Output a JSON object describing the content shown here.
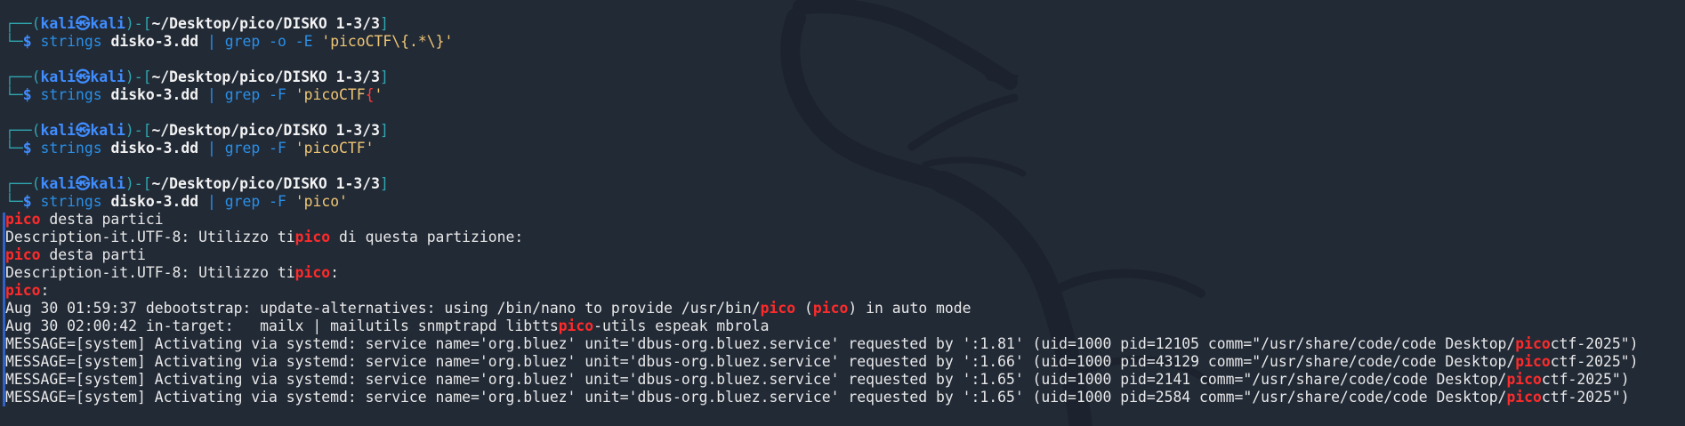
{
  "prompt": {
    "box_top": "┌──(",
    "box_bottom": "└─",
    "user": "kali㉿kali",
    "sep_open": ")-[",
    "path": "~/Desktop/pico/DISKO 1-3/3",
    "sep_close": "]",
    "dollar": "$"
  },
  "commands": [
    {
      "cmd": "strings",
      "file": "disko-3.dd",
      "pipe": "|",
      "grep": "grep -o -E",
      "pattern_pre": "'picoCTF\\{.*\\}'",
      "pattern_brace": "",
      "pattern_post": ""
    },
    {
      "cmd": "strings",
      "file": "disko-3.dd",
      "pipe": "|",
      "grep": "grep -F",
      "pattern_pre": "'picoCTF",
      "pattern_brace": "{",
      "pattern_post": "'"
    },
    {
      "cmd": "strings",
      "file": "disko-3.dd",
      "pipe": "|",
      "grep": "grep -F",
      "pattern_pre": "'picoCTF'",
      "pattern_brace": "",
      "pattern_post": ""
    },
    {
      "cmd": "strings",
      "file": "disko-3.dd",
      "pipe": "|",
      "grep": "grep -F",
      "pattern_pre": "'pico'",
      "pattern_brace": "",
      "pattern_post": ""
    }
  ],
  "output": [
    {
      "a": "",
      "m": "pico",
      "b": " desta partici",
      "m2": "",
      "c": "",
      "m3": "",
      "d": ""
    },
    {
      "a": "Description-it.UTF-8: Utilizzo ti",
      "m": "pico",
      "b": " di questa partizione:",
      "m2": "",
      "c": "",
      "m3": "",
      "d": ""
    },
    {
      "a": "",
      "m": "pico",
      "b": " desta parti",
      "m2": "",
      "c": "",
      "m3": "",
      "d": ""
    },
    {
      "a": "Description-it.UTF-8: Utilizzo ti",
      "m": "pico",
      "b": ":",
      "m2": "",
      "c": "",
      "m3": "",
      "d": ""
    },
    {
      "a": "",
      "m": "pico",
      "b": ":",
      "m2": "",
      "c": "",
      "m3": "",
      "d": ""
    },
    {
      "a": "Aug 30 01:59:37 debootstrap: update-alternatives: using /bin/nano to provide /usr/bin/",
      "m": "pico",
      "b": " (",
      "m2": "pico",
      "c": ") in auto mode",
      "m3": "",
      "d": ""
    },
    {
      "a": "Aug 30 02:00:42 in-target:   mailx | mailutils snmptrapd libtts",
      "m": "pico",
      "b": "-utils espeak mbrola",
      "m2": "",
      "c": "",
      "m3": "",
      "d": ""
    },
    {
      "a": "MESSAGE=[system] Activating via systemd: service name='org.bluez' unit='dbus-org.bluez.service' requested by ':1.81' (uid=1000 pid=12105 comm=\"/usr/share/code/code Desktop/",
      "m": "pico",
      "b": "ctf-2025\")",
      "m2": "",
      "c": "",
      "m3": "",
      "d": ""
    },
    {
      "a": "MESSAGE=[system] Activating via systemd: service name='org.bluez' unit='dbus-org.bluez.service' requested by ':1.66' (uid=1000 pid=43129 comm=\"/usr/share/code/code Desktop/",
      "m": "pico",
      "b": "ctf-2025\")",
      "m2": "",
      "c": "",
      "m3": "",
      "d": ""
    },
    {
      "a": "MESSAGE=[system] Activating via systemd: service name='org.bluez' unit='dbus-org.bluez.service' requested by ':1.65' (uid=1000 pid=2141 comm=\"/usr/share/code/code Desktop/",
      "m": "pico",
      "b": "ctf-2025\")",
      "m2": "",
      "c": "",
      "m3": "",
      "d": ""
    },
    {
      "a": "MESSAGE=[system] Activating via systemd: service name='org.bluez' unit='dbus-org.bluez.service' requested by ':1.65' (uid=1000 pid=2584 comm=\"/usr/share/code/code Desktop/",
      "m": "pico",
      "b": "ctf-2025\")",
      "m2": "",
      "c": "",
      "m3": "",
      "d": ""
    }
  ],
  "colors": {
    "background": "#222a36",
    "prompt_box": "#2fa6b0",
    "user": "#3f8dff",
    "command": "#2a8fe6",
    "string": "#f0c674",
    "match": "#ff2a2a"
  },
  "icons": {
    "background": "kali-dragon-watermark"
  }
}
